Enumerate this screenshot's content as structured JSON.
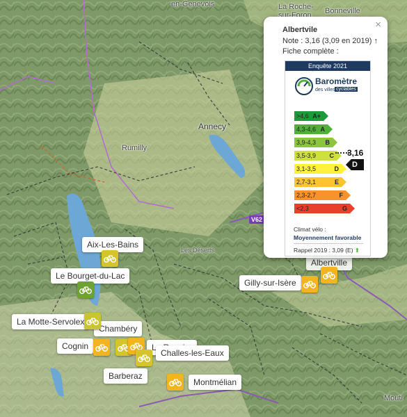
{
  "map": {
    "places": [
      {
        "name": "en-Genevois",
        "key": "p1"
      },
      {
        "name": "La Roche-",
        "key": "p2a"
      },
      {
        "name": "sur-Foron",
        "key": "p2b"
      },
      {
        "name": "Bonneville",
        "key": "p3"
      },
      {
        "name": "Annecy",
        "key": "p4"
      },
      {
        "name": "Rumilly",
        "key": "p5"
      },
      {
        "name": "Les Déserts",
        "key": "p6"
      },
      {
        "name": "Mouti",
        "key": "p7"
      }
    ],
    "road_shield": "V62",
    "cities": [
      {
        "label": "Aix-Les-Bains",
        "color": "#d6c52a"
      },
      {
        "label": "Le Bourget-du-Lac",
        "color": "#6fa331"
      },
      {
        "label": "La Motte-Servolex",
        "color": "#c9c433"
      },
      {
        "label": "Chambéry",
        "color": "#d6c52a"
      },
      {
        "label": "Cognin",
        "color": "#f2b51f"
      },
      {
        "label": "La Ravoire",
        "color": "#f2b51f"
      },
      {
        "label": "Challes-les-Eaux",
        "color": "#d6c52a"
      },
      {
        "label": "Barberaz",
        "color": "#d6c52a"
      },
      {
        "label": "Montmélian",
        "color": "#f2b51f"
      },
      {
        "label": "Gilly-sur-Isère",
        "color": "#f2b51f"
      },
      {
        "label": "Albertville",
        "color": "#f2b51f"
      }
    ],
    "marker_icon": "bicycle-icon"
  },
  "popup": {
    "title": "Albertvile",
    "note_line": "Note : 3,16 (3,09 en 2019) ↑",
    "fiche_line": "Fiche complète :",
    "close": "×",
    "barometre": {
      "header": "Enquête 2021",
      "logo_word": "Baromètre",
      "logo_sub": "des villes",
      "logo_tag": "cyclables",
      "grades": [
        {
          "range": ">4,6",
          "letter": "A+",
          "color": "#1e9a3c"
        },
        {
          "range": "4,3-4,6",
          "letter": "A",
          "color": "#4fb03a"
        },
        {
          "range": "3,9-4,3",
          "letter": "B",
          "color": "#8cc63e"
        },
        {
          "range": "3,5-3,9",
          "letter": "C",
          "color": "#cde03c"
        },
        {
          "range": "3,1-3,5",
          "letter": "D",
          "color": "#fff13c"
        },
        {
          "range": "2,7-3,1",
          "letter": "E",
          "color": "#fcc530"
        },
        {
          "range": "2,3-2,7",
          "letter": "F",
          "color": "#f7932c"
        },
        {
          "range": "<2,3",
          "letter": "G",
          "color": "#e8402b"
        }
      ],
      "score": "3,16",
      "score_letter": "D",
      "climat_label": "Climat vélo :",
      "climat_value": "Moyennement favorable",
      "rappel": "Rappel 2019 : 3,09 (E)",
      "rappel_arrow": "⬆"
    }
  }
}
